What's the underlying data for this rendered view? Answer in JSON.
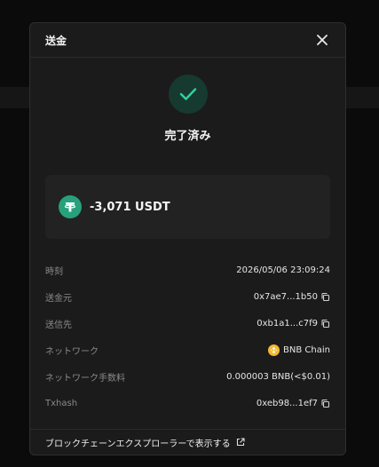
{
  "modal": {
    "title": "送金",
    "status": "完了済み",
    "amount": "-3,071 USDT",
    "token_icon": "tether-icon",
    "footer_link": "ブロックチェーンエクスプローラーで表示する"
  },
  "details": {
    "time": {
      "label": "時刻",
      "value": "2026/05/06 23:09:24"
    },
    "from": {
      "label": "送金元",
      "value": "0x7ae7...1b50"
    },
    "to": {
      "label": "送信先",
      "value": "0xb1a1...c7f9"
    },
    "network": {
      "label": "ネットワーク",
      "value": "BNB Chain"
    },
    "fee": {
      "label": "ネットワーク手数料",
      "value": "0.000003 BNB(<$0.01)"
    },
    "txhash": {
      "label": "Txhash",
      "value": "0xeb98...1ef7"
    }
  },
  "colors": {
    "success": "#2ed3a0",
    "tether": "#26a17b",
    "bnb": "#f3ba2f"
  }
}
